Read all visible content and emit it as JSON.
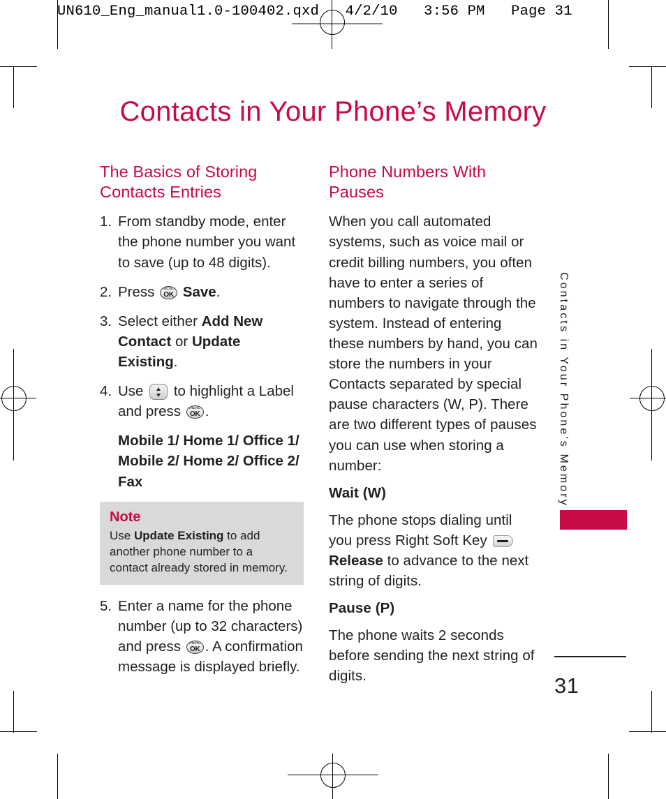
{
  "slug": {
    "text": "UN610_Eng_manual1.0-100402.qxd   4/2/10   3:56 PM   Page 31"
  },
  "page": {
    "title": "Contacts in Your Phone’s Memory",
    "folio_number": "31",
    "side_tab_text": "Contacts in Your Phone’s Memory",
    "accent_color": "#c80a45",
    "note_bg_color": "#d9d9d9",
    "text_color": "#231f20"
  },
  "left_column": {
    "heading": "The Basics of Storing Contacts Entries",
    "steps": [
      {
        "num": "1.",
        "parts": [
          {
            "type": "text",
            "value": "From standby mode, enter the phone number you want to save (up to 48 digits)."
          }
        ]
      },
      {
        "num": "2.",
        "parts": [
          {
            "type": "text",
            "value": "Press "
          },
          {
            "type": "icon",
            "value": "menu-ok-key"
          },
          {
            "type": "bold",
            "value": " Save"
          },
          {
            "type": "text",
            "value": "."
          }
        ]
      },
      {
        "num": "3.",
        "parts": [
          {
            "type": "text",
            "value": "Select either "
          },
          {
            "type": "bold",
            "value": "Add New Contact"
          },
          {
            "type": "text",
            "value": " or "
          },
          {
            "type": "bold",
            "value": "Update Existing"
          },
          {
            "type": "text",
            "value": "."
          }
        ]
      },
      {
        "num": "4.",
        "parts": [
          {
            "type": "text",
            "value": "Use "
          },
          {
            "type": "icon",
            "value": "nav-updown-key"
          },
          {
            "type": "text",
            "value": " to highlight a Label and press "
          },
          {
            "type": "icon",
            "value": "menu-ok-key"
          },
          {
            "type": "text",
            "value": "."
          }
        ]
      }
    ],
    "labels_line": "Mobile 1/ Home 1/ Office 1/ Mobile 2/ Home 2/ Office 2/ Fax",
    "note": {
      "title": "Note",
      "parts": [
        {
          "type": "text",
          "value": "Use "
        },
        {
          "type": "bold",
          "value": "Update Existing"
        },
        {
          "type": "text",
          "value": " to add another phone number to a contact already stored in memory."
        }
      ]
    },
    "step5": {
      "num": "5.",
      "parts": [
        {
          "type": "text",
          "value": "Enter a name for the phone number (up to 32 characters) and press "
        },
        {
          "type": "icon",
          "value": "menu-ok-key"
        },
        {
          "type": "text",
          "value": ". A confirmation message is displayed briefly."
        }
      ]
    }
  },
  "right_column": {
    "heading": "Phone Numbers With Pauses",
    "intro": "When you call automated systems, such as voice mail or credit billing numbers, you often have to enter a series of numbers to navigate through the system. Instead of entering these numbers by hand, you can store the numbers in your Contacts separated by special pause characters (W, P). There are two different types of pauses you can use when storing a number:",
    "sections": [
      {
        "subheading": "Wait (W)",
        "parts": [
          {
            "type": "text",
            "value": "The phone stops dialing until you press Right Soft Key "
          },
          {
            "type": "icon",
            "value": "right-soft-key"
          },
          {
            "type": "bold",
            "value": " Release"
          },
          {
            "type": "text",
            "value": " to advance to the next string of digits."
          }
        ]
      },
      {
        "subheading": "Pause (P)",
        "parts": [
          {
            "type": "text",
            "value": "The phone waits 2 seconds before sending the next string of digits."
          }
        ]
      }
    ]
  },
  "icons": {
    "menu_ok_key": {
      "top_label": "MENU",
      "bottom_label": "OK"
    },
    "nav_updown_key": {
      "name": "nav-updown-key"
    },
    "right_soft_key": {
      "name": "right-soft-key"
    }
  }
}
